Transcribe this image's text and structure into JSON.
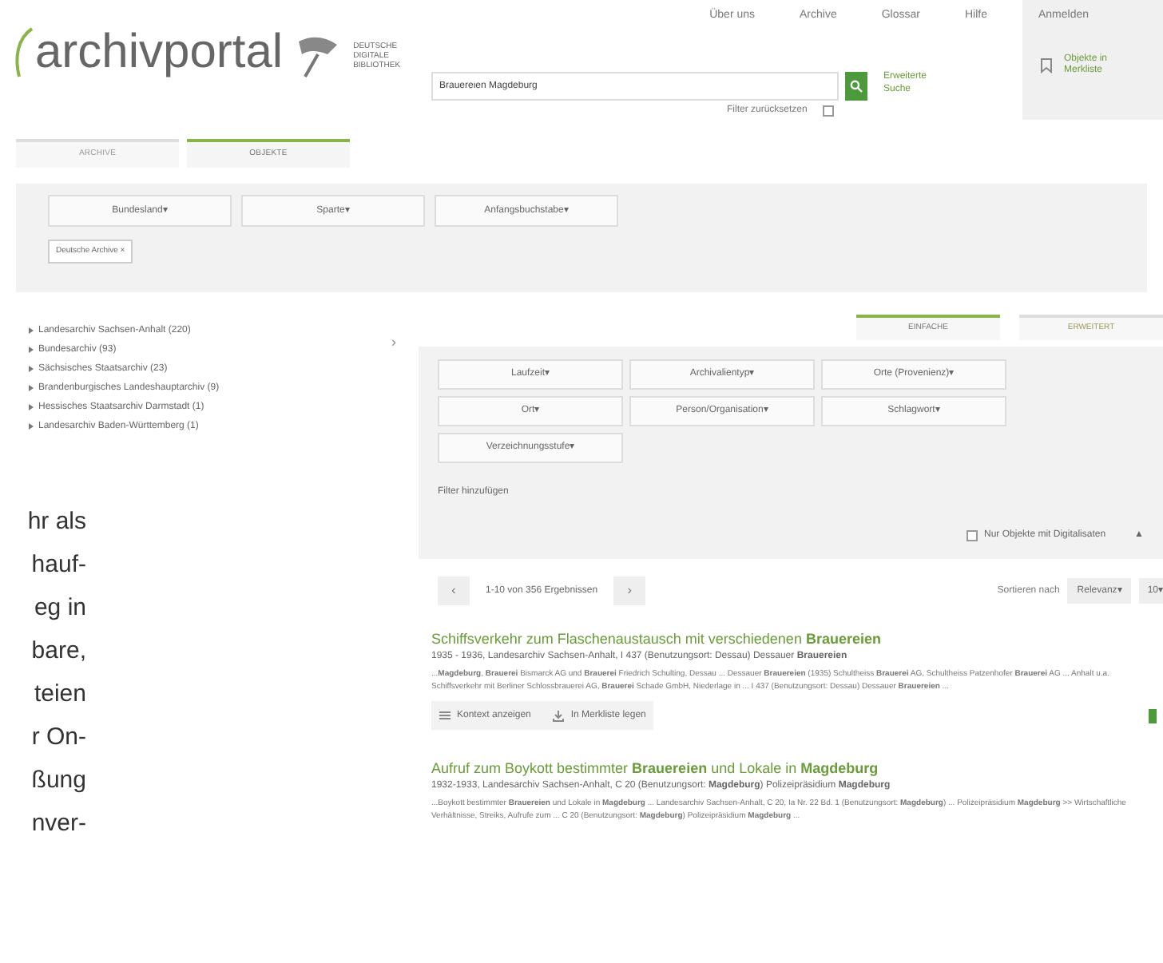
{
  "header": {
    "logo": "archivportal",
    "partner_logo": "DEUTSCHE DIGITALE BIBLIOTHEK",
    "nav": [
      "Über uns",
      "Archive",
      "Glossar",
      "Hilfe"
    ],
    "login": "Anmelden",
    "bookmarks": "Objekte in Merkliste",
    "search": {
      "value": "Brauereien Magdeburg"
    },
    "advanced_search": "Erweiterte Suche",
    "reset_filters": {
      "label": "Filter zurücksetzen",
      "checked": false
    }
  },
  "tabs": [
    {
      "label": "ARCHIVE",
      "selected": false
    },
    {
      "label": "OBJEKTE",
      "selected": true
    }
  ],
  "archive_filters": {
    "buttons": [
      "Bundesland▾",
      "Sparte▾",
      "Anfangsbuchstabe▾"
    ],
    "chip": "Deutsche Archive ×"
  },
  "archive_list": [
    "Landesarchiv Sachsen-Anhalt (220)",
    "Bundesarchiv (93)",
    "Sächsisches Staatsarchiv (23)",
    "Brandenburgisches Landeshauptarchiv (9)",
    "Hessisches Staatsarchiv Darmstadt (1)",
    "Landesarchiv Baden-Württemberg (1)"
  ],
  "collapse_arrow": "›",
  "view_tabs": [
    {
      "label": "EINFACHE",
      "selected": true
    },
    {
      "label": "ERWEITERT",
      "selected": false
    }
  ],
  "facets": {
    "buttons": [
      "Laufzeit▾",
      "Archivalientyp▾",
      "Orte (Provenienz)▾",
      "Ort▾",
      "Person/Organisation▾",
      "Schlagwort▾",
      "Verzeichnungsstufe▾"
    ],
    "add_filter": "Filter hinzufügen",
    "digitized_only": {
      "label": "Nur Objekte mit Digitalisaten",
      "checked": false
    },
    "collapse": "▲"
  },
  "pagination": {
    "prev": "‹",
    "summary": "1-10 von 356 Ergebnissen",
    "next": "›",
    "sort_label": "Sortieren nach",
    "sort": "Relevanz▾",
    "per_page": "10▾"
  },
  "results": [
    {
      "title": "Schiffsverkehr zum Flaschenaustausch mit verschiedenen **Brauereien**",
      "meta": "1935 - 1936, Landesarchiv Sachsen-Anhalt, I 437 (Benutzungsort: Dessau) Dessauer **Brauereien**",
      "snippet": "...**Magdeburg**, **Brauerei** Bismarck AG und **Brauerei** Friedrich Schulting, Dessau ... Dessauer **Brauereien** (1935) Schultheiss **Brauerei** AG, Schultheiss Patzenhofer **Brauerei** AG ... Anhalt u.a. Schiffsverkehr mit Berliner Schlossbrauerei AG, **Brauerei** Schade GmbH, Niederlage in ... I 437 (Benutzungsort: Dessau) Dessauer **Brauereien** ...",
      "actions": [
        "Kontext anzeigen",
        "In Merkliste legen"
      ]
    },
    {
      "title": "Aufruf zum Boykott bestimmter **Brauereien** und Lokale in **Magdeburg**",
      "meta": "1932-1933, Landesarchiv Sachsen-Anhalt, C 20 (Benutzungsort: **Magdeburg**) Polizeipräsidium **Magdeburg**",
      "snippet": "...Boykott bestimmter **Brauereien** und Lokale in **Magdeburg** ... Landesarchiv Sachsen-Anhalt, C 20, Ia Nr. 22 Bd. 1 (Benutzungsort: **Magdeburg**) ... Polizeipräsidium **Magdeburg** >> Wirtschaftliche Verhältnisse, Streiks, Aufrufe zum ... C 20 (Benutzungsort: **Magdeburg**) Polizeipräsidium **Magdeburg** ..."
    }
  ],
  "page_text_fragments": [
    "hr als",
    "hauf-",
    "eg in",
    "bare,",
    "teien",
    "r On-",
    "ßung",
    "nver-"
  ]
}
